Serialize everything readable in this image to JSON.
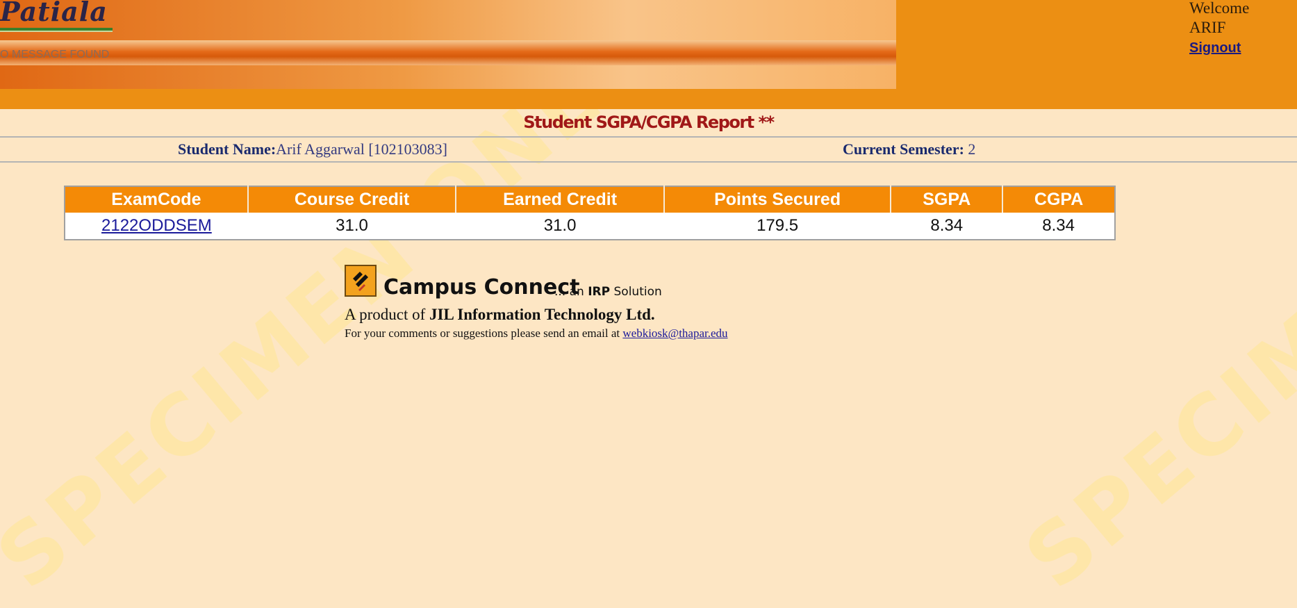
{
  "header": {
    "logo_text": "Patiala",
    "marquee": "O MESSAGE FOUND",
    "welcome": "Welcome",
    "user": "ARIF",
    "signout": "Signout"
  },
  "report": {
    "title": "Student SGPA/CGPA Report **",
    "student_name_label": "Student Name:",
    "student_name_value": "Arif Aggarwal [102103083]",
    "semester_label": "Current Semester:",
    "semester_value": "2"
  },
  "table": {
    "headers": [
      "ExamCode",
      "Course Credit",
      "Earned Credit",
      "Points Secured",
      "SGPA",
      "CGPA"
    ],
    "rows": [
      [
        "2122ODDSEM",
        "31.0",
        "31.0",
        "179.5",
        "8.34",
        "8.34"
      ]
    ]
  },
  "footer": {
    "brand": "Campus Connect",
    "brand_sub_prefix": "... an",
    "brand_sub_bold": "IRP",
    "brand_sub_suffix": "Solution",
    "product_prefix": "A product of",
    "product_company": "JIL Information Technology Ltd.",
    "comments_text": "For your comments or suggestions please send an email at",
    "email": "webkiosk@thapar.edu"
  },
  "watermark_text": "SPECIMEN ONLY",
  "colors": {
    "header_orange": "#ec8f13",
    "table_header": "#f48a06",
    "page_bg": "#fde6c4",
    "title_red": "#a01818",
    "label_navy": "#1a2a6e"
  }
}
